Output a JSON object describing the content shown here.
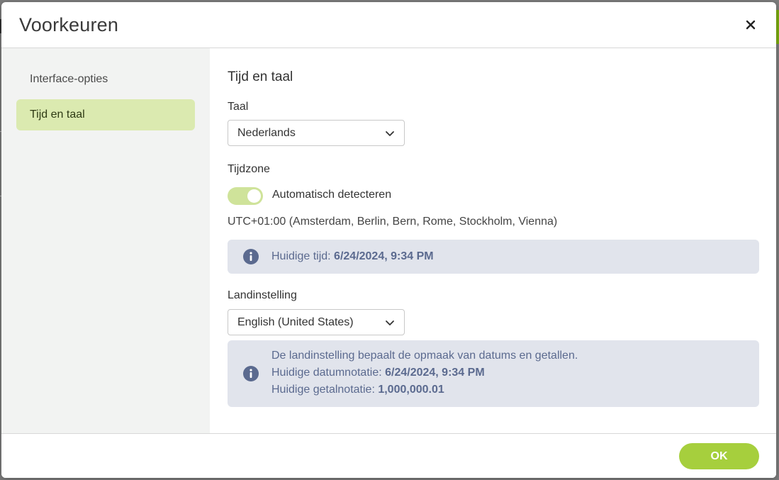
{
  "dialog": {
    "title": "Voorkeuren",
    "close_label": "×"
  },
  "sidebar": {
    "items": [
      {
        "label": "Interface-opties",
        "active": false
      },
      {
        "label": "Tijd en taal",
        "active": true
      }
    ]
  },
  "content": {
    "section_title": "Tijd en taal",
    "language": {
      "label": "Taal",
      "selected": "Nederlands"
    },
    "timezone": {
      "label": "Tijdzone",
      "auto_detect_label": "Automatisch detecteren",
      "auto_detect_on": true,
      "zone_text": "UTC+01:00 (Amsterdam, Berlin, Bern, Rome, Stockholm, Vienna)",
      "info": {
        "prefix": "Huidige tijd: ",
        "value": "6/24/2024, 9:34 PM"
      }
    },
    "locale": {
      "label": "Landinstelling",
      "selected": "English (United States)",
      "info": {
        "line1": "De landinstelling bepaalt de opmaak van datums en getallen.",
        "date_prefix": "Huidige datumnotatie: ",
        "date_value": "6/24/2024, 9:34 PM",
        "number_prefix": "Huidige getalnotatie: ",
        "number_value": "1,000,000.01"
      }
    }
  },
  "footer": {
    "ok_label": "OK"
  },
  "colors": {
    "accent": "#a6cf3d",
    "active_bg": "#dbeab0",
    "info_bg": "#e1e4ec",
    "info_text": "#5b6a8f"
  },
  "icons": {
    "close": "close-icon",
    "chevron": "chevron-down-icon",
    "info": "info-icon"
  }
}
